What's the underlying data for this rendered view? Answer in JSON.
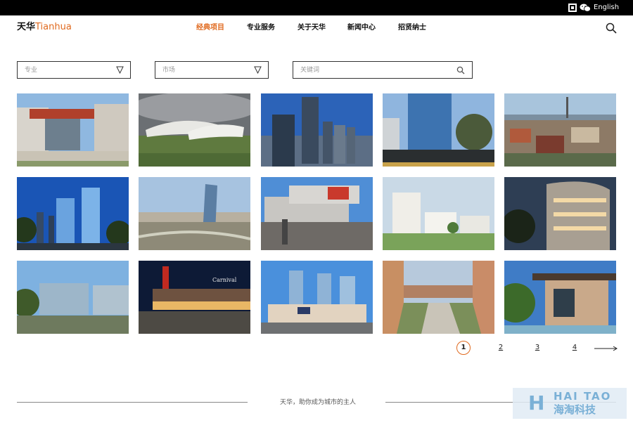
{
  "topbar": {
    "lang_label": "English",
    "qr_icon": "qr-code-icon",
    "wechat_icon": "wechat-icon"
  },
  "header": {
    "logo_cn": "天华",
    "logo_en": "Tianhua",
    "nav": [
      {
        "label": "经典项目",
        "active": true
      },
      {
        "label": "专业服务",
        "active": false
      },
      {
        "label": "关于天华",
        "active": false
      },
      {
        "label": "新闻中心",
        "active": false
      },
      {
        "label": "招贤纳士",
        "active": false
      }
    ],
    "search_icon": "search-icon"
  },
  "filters": {
    "discipline_placeholder": "专业",
    "market_placeholder": "市场",
    "keyword_placeholder": "关键词"
  },
  "projects": [
    {
      "image": "red-cantilever-building"
    },
    {
      "image": "white-wave-pavilion"
    },
    {
      "image": "twin-dark-towers"
    },
    {
      "image": "glass-tower-garden"
    },
    {
      "image": "waterfront-aerial"
    },
    {
      "image": "twin-blue-towers"
    },
    {
      "image": "twisting-tower-river"
    },
    {
      "image": "stacked-box-building"
    },
    {
      "image": "white-residential-blocks"
    },
    {
      "image": "curved-glass-residence"
    },
    {
      "image": "office-campus"
    },
    {
      "image": "night-retail"
    },
    {
      "image": "mall-with-towers"
    },
    {
      "image": "elevated-walkway-plaza"
    },
    {
      "image": "villa-pool"
    }
  ],
  "pagination": {
    "pages": [
      "1",
      "2",
      "3",
      "4"
    ],
    "current": "1",
    "next_icon": "long-arrow-right-icon"
  },
  "footer": {
    "slogan": "天华，助你成为城市的主人"
  },
  "watermark": {
    "letter": "H",
    "line1": "HAI TAO",
    "line2": "海淘科技"
  },
  "colors": {
    "accent": "#e06a1f",
    "topbar": "#000000"
  }
}
